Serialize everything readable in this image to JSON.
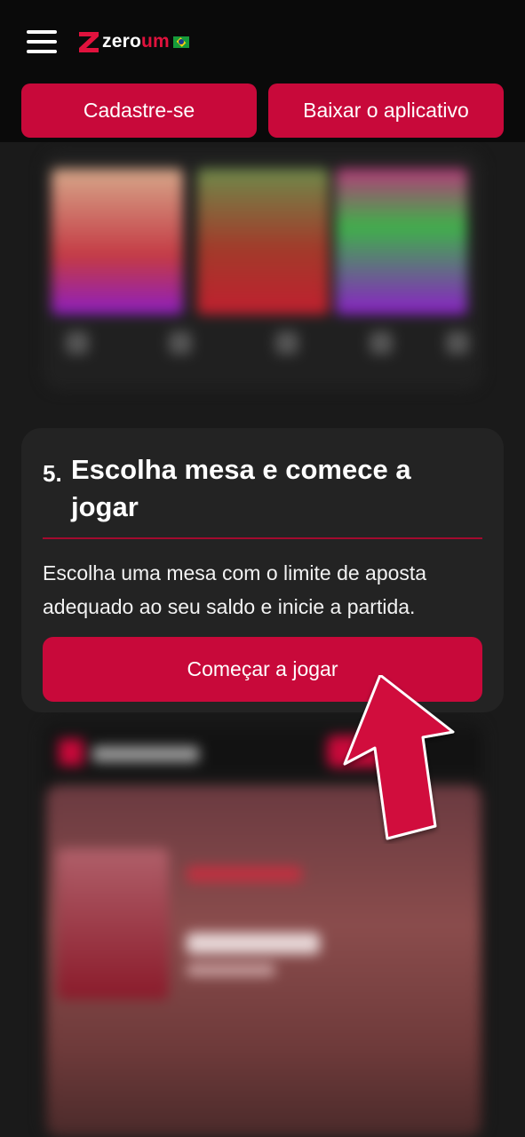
{
  "header": {
    "logo": {
      "part1": "zero",
      "part2": "um"
    },
    "register_label": "Cadastre-se",
    "app_label": "Baixar o aplicativo"
  },
  "step": {
    "number": "5.",
    "title": "Escolha mesa e comece a jogar",
    "description": "Escolha uma mesa com o limite de aposta adequado ao seu saldo e inicie a partida.",
    "button_label": "Começar a jogar"
  },
  "colors": {
    "accent": "#c8093a",
    "background": "#111111",
    "card": "#232323"
  },
  "icons": [
    "menu-icon",
    "zeroum-logo",
    "brazil-flag-icon",
    "pointer-arrow-icon"
  ]
}
